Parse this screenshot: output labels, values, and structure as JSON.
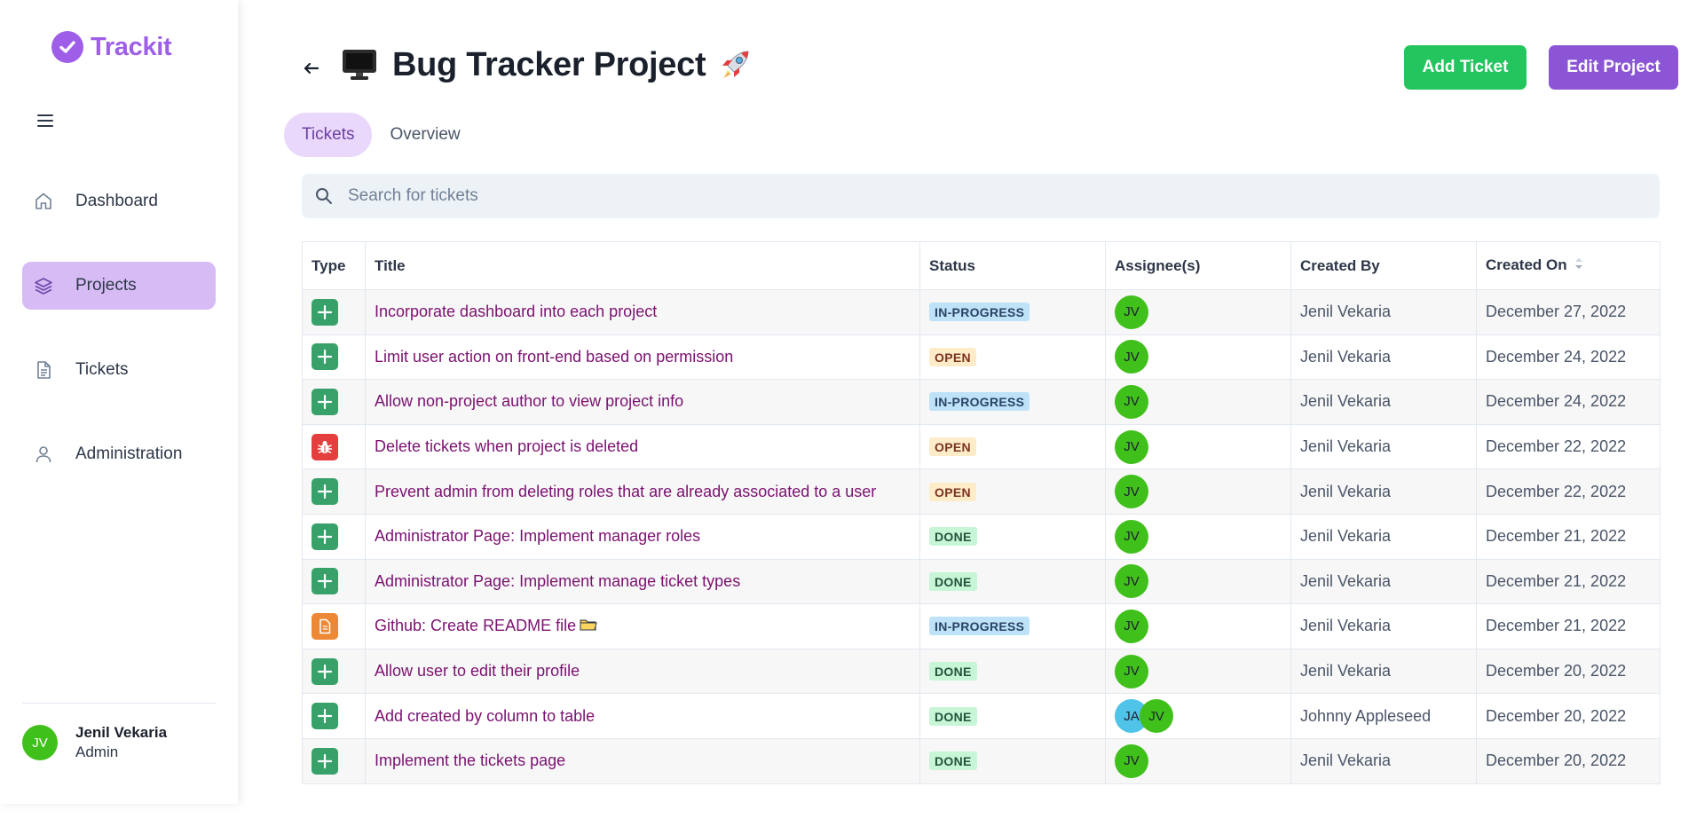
{
  "brand": {
    "name": "Trackit"
  },
  "sidebar": {
    "items": [
      {
        "label": "Dashboard",
        "icon": "home-icon"
      },
      {
        "label": "Projects",
        "icon": "layers-icon",
        "active": true
      },
      {
        "label": "Tickets",
        "icon": "document-icon"
      },
      {
        "label": "Administration",
        "icon": "user-icon"
      }
    ],
    "user": {
      "initials": "JV",
      "name": "Jenil Vekaria",
      "role": "Admin"
    }
  },
  "header": {
    "title": "Bug Tracker Project",
    "add_ticket_label": "Add Ticket",
    "edit_project_label": "Edit Project"
  },
  "tabs": [
    {
      "label": "Tickets",
      "active": true
    },
    {
      "label": "Overview",
      "active": false
    }
  ],
  "search": {
    "placeholder": "Search for tickets",
    "value": ""
  },
  "table": {
    "columns": [
      "Type",
      "Title",
      "Status",
      "Assignee(s)",
      "Created By",
      "Created On"
    ],
    "rows": [
      {
        "type": "feature",
        "title": "Incorporate dashboard into each project",
        "status": "IN-PROGRESS",
        "assignees": [
          "JV"
        ],
        "created_by": "Jenil Vekaria",
        "created_on": "December 27, 2022"
      },
      {
        "type": "feature",
        "title": "Limit user action on front-end based on permission",
        "status": "OPEN",
        "assignees": [
          "JV"
        ],
        "created_by": "Jenil Vekaria",
        "created_on": "December 24, 2022"
      },
      {
        "type": "feature",
        "title": "Allow non-project author to view project info",
        "status": "IN-PROGRESS",
        "assignees": [
          "JV"
        ],
        "created_by": "Jenil Vekaria",
        "created_on": "December 24, 2022"
      },
      {
        "type": "bug",
        "title": "Delete tickets when project is deleted",
        "status": "OPEN",
        "assignees": [
          "JV"
        ],
        "created_by": "Jenil Vekaria",
        "created_on": "December 22, 2022"
      },
      {
        "type": "feature",
        "title": "Prevent admin from deleting roles that are already associated to a user",
        "status": "OPEN",
        "assignees": [
          "JV"
        ],
        "created_by": "Jenil Vekaria",
        "created_on": "December 22, 2022"
      },
      {
        "type": "feature",
        "title": "Administrator Page: Implement manager roles",
        "status": "DONE",
        "assignees": [
          "JV"
        ],
        "created_by": "Jenil Vekaria",
        "created_on": "December 21, 2022"
      },
      {
        "type": "feature",
        "title": "Administrator Page: Implement manage ticket types",
        "status": "DONE",
        "assignees": [
          "JV"
        ],
        "created_by": "Jenil Vekaria",
        "created_on": "December 21, 2022"
      },
      {
        "type": "doc",
        "title": "Github: Create README file",
        "status": "IN-PROGRESS",
        "assignees": [
          "JV"
        ],
        "created_by": "Jenil Vekaria",
        "created_on": "December 21, 2022",
        "title_icon": "folder-icon"
      },
      {
        "type": "feature",
        "title": "Allow user to edit their profile",
        "status": "DONE",
        "assignees": [
          "JV"
        ],
        "created_by": "Jenil Vekaria",
        "created_on": "December 20, 2022"
      },
      {
        "type": "feature",
        "title": "Add created by column to table",
        "status": "DONE",
        "assignees": [
          "JA",
          "JV"
        ],
        "created_by": "Johnny Appleseed",
        "created_on": "December 20, 2022"
      },
      {
        "type": "feature",
        "title": "Implement the tickets page",
        "status": "DONE",
        "assignees": [
          "JV"
        ],
        "created_by": "Jenil Vekaria",
        "created_on": "December 20, 2022"
      }
    ]
  },
  "colors": {
    "brand": "#9f5ee8",
    "add_button": "#22c55e",
    "edit_button": "#8b55d6",
    "active_nav": "#d7bbf5",
    "title_link": "#7b1170"
  }
}
